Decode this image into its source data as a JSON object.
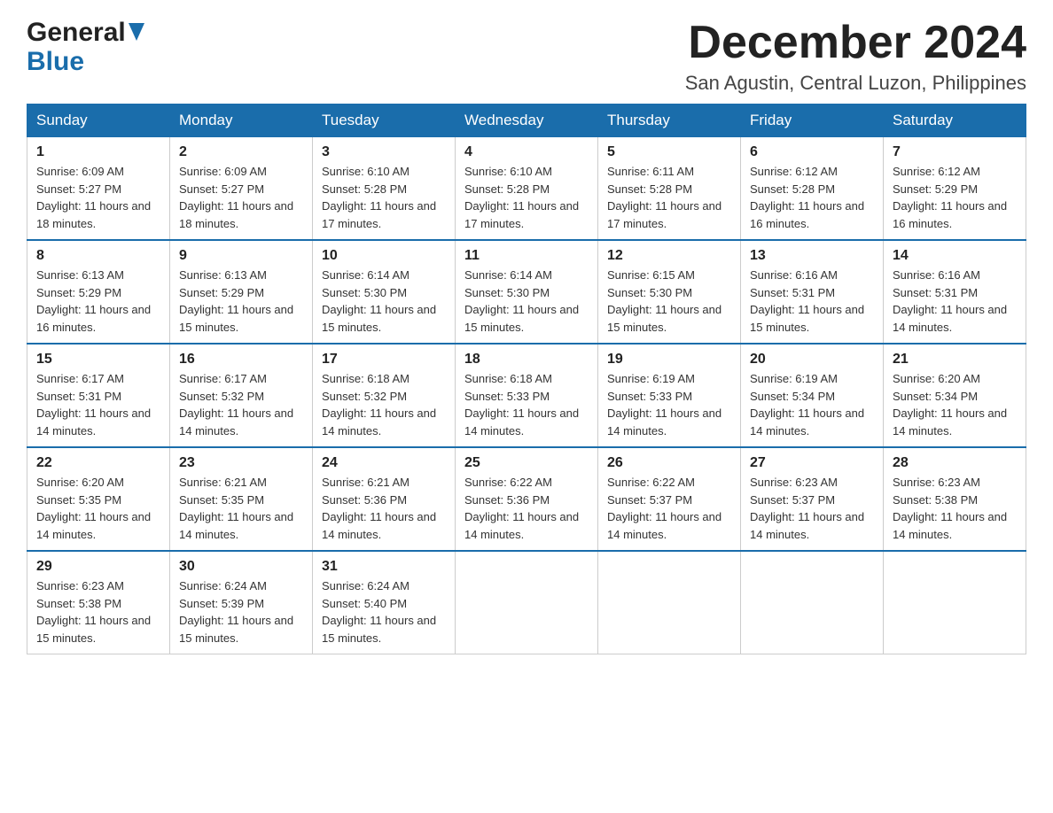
{
  "header": {
    "logo_general": "General",
    "logo_blue": "Blue",
    "month_title": "December 2024",
    "location": "San Agustin, Central Luzon, Philippines"
  },
  "days_of_week": [
    "Sunday",
    "Monday",
    "Tuesday",
    "Wednesday",
    "Thursday",
    "Friday",
    "Saturday"
  ],
  "weeks": [
    [
      {
        "day": "1",
        "sunrise": "6:09 AM",
        "sunset": "5:27 PM",
        "daylight": "11 hours and 18 minutes."
      },
      {
        "day": "2",
        "sunrise": "6:09 AM",
        "sunset": "5:27 PM",
        "daylight": "11 hours and 18 minutes."
      },
      {
        "day": "3",
        "sunrise": "6:10 AM",
        "sunset": "5:28 PM",
        "daylight": "11 hours and 17 minutes."
      },
      {
        "day": "4",
        "sunrise": "6:10 AM",
        "sunset": "5:28 PM",
        "daylight": "11 hours and 17 minutes."
      },
      {
        "day": "5",
        "sunrise": "6:11 AM",
        "sunset": "5:28 PM",
        "daylight": "11 hours and 17 minutes."
      },
      {
        "day": "6",
        "sunrise": "6:12 AM",
        "sunset": "5:28 PM",
        "daylight": "11 hours and 16 minutes."
      },
      {
        "day": "7",
        "sunrise": "6:12 AM",
        "sunset": "5:29 PM",
        "daylight": "11 hours and 16 minutes."
      }
    ],
    [
      {
        "day": "8",
        "sunrise": "6:13 AM",
        "sunset": "5:29 PM",
        "daylight": "11 hours and 16 minutes."
      },
      {
        "day": "9",
        "sunrise": "6:13 AM",
        "sunset": "5:29 PM",
        "daylight": "11 hours and 15 minutes."
      },
      {
        "day": "10",
        "sunrise": "6:14 AM",
        "sunset": "5:30 PM",
        "daylight": "11 hours and 15 minutes."
      },
      {
        "day": "11",
        "sunrise": "6:14 AM",
        "sunset": "5:30 PM",
        "daylight": "11 hours and 15 minutes."
      },
      {
        "day": "12",
        "sunrise": "6:15 AM",
        "sunset": "5:30 PM",
        "daylight": "11 hours and 15 minutes."
      },
      {
        "day": "13",
        "sunrise": "6:16 AM",
        "sunset": "5:31 PM",
        "daylight": "11 hours and 15 minutes."
      },
      {
        "day": "14",
        "sunrise": "6:16 AM",
        "sunset": "5:31 PM",
        "daylight": "11 hours and 14 minutes."
      }
    ],
    [
      {
        "day": "15",
        "sunrise": "6:17 AM",
        "sunset": "5:31 PM",
        "daylight": "11 hours and 14 minutes."
      },
      {
        "day": "16",
        "sunrise": "6:17 AM",
        "sunset": "5:32 PM",
        "daylight": "11 hours and 14 minutes."
      },
      {
        "day": "17",
        "sunrise": "6:18 AM",
        "sunset": "5:32 PM",
        "daylight": "11 hours and 14 minutes."
      },
      {
        "day": "18",
        "sunrise": "6:18 AM",
        "sunset": "5:33 PM",
        "daylight": "11 hours and 14 minutes."
      },
      {
        "day": "19",
        "sunrise": "6:19 AM",
        "sunset": "5:33 PM",
        "daylight": "11 hours and 14 minutes."
      },
      {
        "day": "20",
        "sunrise": "6:19 AM",
        "sunset": "5:34 PM",
        "daylight": "11 hours and 14 minutes."
      },
      {
        "day": "21",
        "sunrise": "6:20 AM",
        "sunset": "5:34 PM",
        "daylight": "11 hours and 14 minutes."
      }
    ],
    [
      {
        "day": "22",
        "sunrise": "6:20 AM",
        "sunset": "5:35 PM",
        "daylight": "11 hours and 14 minutes."
      },
      {
        "day": "23",
        "sunrise": "6:21 AM",
        "sunset": "5:35 PM",
        "daylight": "11 hours and 14 minutes."
      },
      {
        "day": "24",
        "sunrise": "6:21 AM",
        "sunset": "5:36 PM",
        "daylight": "11 hours and 14 minutes."
      },
      {
        "day": "25",
        "sunrise": "6:22 AM",
        "sunset": "5:36 PM",
        "daylight": "11 hours and 14 minutes."
      },
      {
        "day": "26",
        "sunrise": "6:22 AM",
        "sunset": "5:37 PM",
        "daylight": "11 hours and 14 minutes."
      },
      {
        "day": "27",
        "sunrise": "6:23 AM",
        "sunset": "5:37 PM",
        "daylight": "11 hours and 14 minutes."
      },
      {
        "day": "28",
        "sunrise": "6:23 AM",
        "sunset": "5:38 PM",
        "daylight": "11 hours and 14 minutes."
      }
    ],
    [
      {
        "day": "29",
        "sunrise": "6:23 AM",
        "sunset": "5:38 PM",
        "daylight": "11 hours and 15 minutes."
      },
      {
        "day": "30",
        "sunrise": "6:24 AM",
        "sunset": "5:39 PM",
        "daylight": "11 hours and 15 minutes."
      },
      {
        "day": "31",
        "sunrise": "6:24 AM",
        "sunset": "5:40 PM",
        "daylight": "11 hours and 15 minutes."
      },
      null,
      null,
      null,
      null
    ]
  ]
}
